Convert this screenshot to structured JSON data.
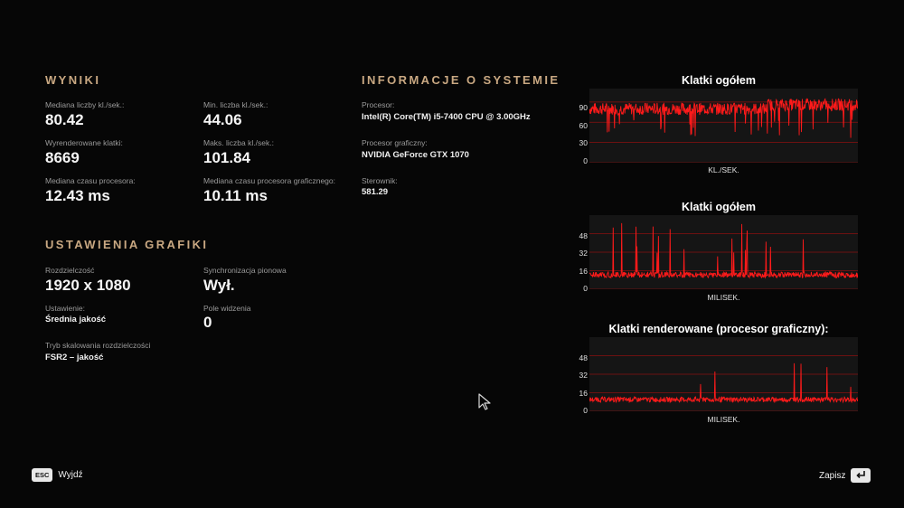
{
  "results": {
    "heading": "WYNIKI",
    "items": [
      {
        "label": "Mediana liczby kl./sek.:",
        "value": "80.42"
      },
      {
        "label": "Min. liczba kl./sek.:",
        "value": "44.06"
      },
      {
        "label": "Wyrenderowane klatki:",
        "value": "8669"
      },
      {
        "label": "Maks. liczba kl./sek.:",
        "value": "101.84"
      },
      {
        "label": "Mediana czasu procesora:",
        "value": "12.43 ms"
      },
      {
        "label": "Mediana czasu procesora graficznego:",
        "value": "10.11 ms"
      }
    ]
  },
  "system": {
    "heading": "INFORMACJE O SYSTEMIE",
    "items": [
      {
        "label": "Procesor:",
        "value": "Intel(R) Core(TM) i5-7400 CPU @ 3.00GHz"
      },
      {
        "label": "Procesor graficzny:",
        "value": "NVIDIA GeForce GTX 1070"
      },
      {
        "label": "Sterownik:",
        "value": "581.29"
      }
    ]
  },
  "graphics": {
    "heading": "USTAWIENIA GRAFIKI",
    "items": [
      {
        "label": "Rozdzielczość",
        "value": "1920 x 1080"
      },
      {
        "label": "Synchronizacja pionowa",
        "value": "Wył."
      },
      {
        "label": "Ustawienie:",
        "value": "Średnia jakość"
      },
      {
        "label": "Pole widzenia",
        "value": "0"
      },
      {
        "label": "Tryb skalowania rozdzielczości",
        "value": "FSR2 – jakość"
      }
    ]
  },
  "charts": [
    {
      "title": "Klatki ogółem",
      "xlabel": "KL./SEK.",
      "yticks": [
        "90",
        "60",
        "30",
        "0"
      ],
      "ymax": 110,
      "base": 80,
      "noise": 9,
      "dips": 20,
      "color": "#ff1a1a"
    },
    {
      "title": "Klatki ogółem",
      "xlabel": "MILISEK.",
      "yticks": [
        "48",
        "32",
        "16",
        "0"
      ],
      "ymax": 64,
      "base": 12.5,
      "noise": 2.5,
      "dips": 0,
      "spikes": 12,
      "color": "#ff1a1a"
    },
    {
      "title": "Klatki renderowane (procesor graficzny):",
      "xlabel": "MILISEK.",
      "yticks": [
        "48",
        "32",
        "16",
        "0"
      ],
      "ymax": 64,
      "base": 10.1,
      "noise": 2.2,
      "dips": 0,
      "spikes": 6,
      "color": "#ff1a1a"
    }
  ],
  "footer": {
    "exit_key": "ESC",
    "exit_label": "Wyjdź",
    "save_label": "Zapisz"
  }
}
